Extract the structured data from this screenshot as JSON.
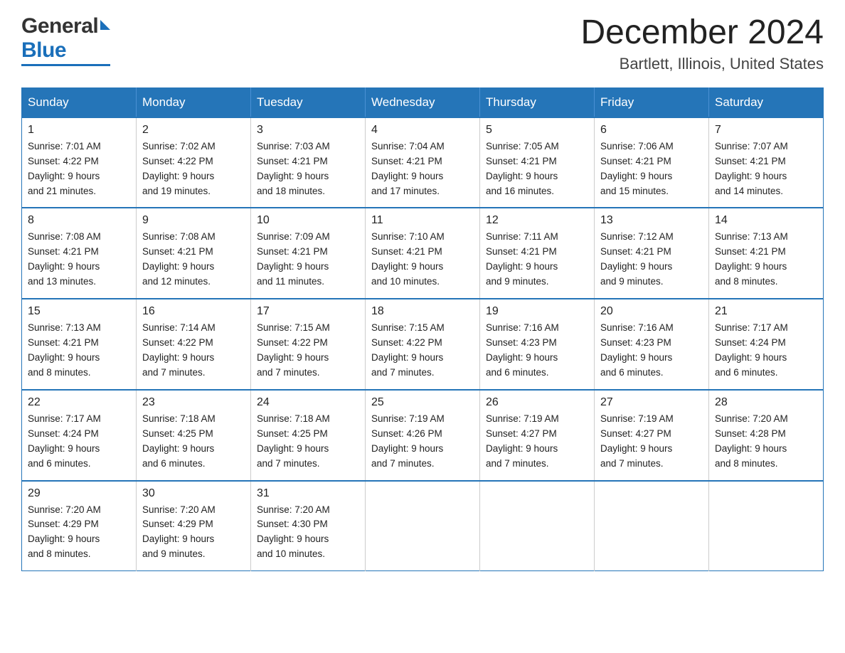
{
  "logo": {
    "general_text": "General",
    "blue_text": "Blue"
  },
  "title": {
    "month_year": "December 2024",
    "location": "Bartlett, Illinois, United States"
  },
  "days_of_week": [
    "Sunday",
    "Monday",
    "Tuesday",
    "Wednesday",
    "Thursday",
    "Friday",
    "Saturday"
  ],
  "weeks": [
    [
      {
        "day": "1",
        "info": "Sunrise: 7:01 AM\nSunset: 4:22 PM\nDaylight: 9 hours\nand 21 minutes."
      },
      {
        "day": "2",
        "info": "Sunrise: 7:02 AM\nSunset: 4:22 PM\nDaylight: 9 hours\nand 19 minutes."
      },
      {
        "day": "3",
        "info": "Sunrise: 7:03 AM\nSunset: 4:21 PM\nDaylight: 9 hours\nand 18 minutes."
      },
      {
        "day": "4",
        "info": "Sunrise: 7:04 AM\nSunset: 4:21 PM\nDaylight: 9 hours\nand 17 minutes."
      },
      {
        "day": "5",
        "info": "Sunrise: 7:05 AM\nSunset: 4:21 PM\nDaylight: 9 hours\nand 16 minutes."
      },
      {
        "day": "6",
        "info": "Sunrise: 7:06 AM\nSunset: 4:21 PM\nDaylight: 9 hours\nand 15 minutes."
      },
      {
        "day": "7",
        "info": "Sunrise: 7:07 AM\nSunset: 4:21 PM\nDaylight: 9 hours\nand 14 minutes."
      }
    ],
    [
      {
        "day": "8",
        "info": "Sunrise: 7:08 AM\nSunset: 4:21 PM\nDaylight: 9 hours\nand 13 minutes."
      },
      {
        "day": "9",
        "info": "Sunrise: 7:08 AM\nSunset: 4:21 PM\nDaylight: 9 hours\nand 12 minutes."
      },
      {
        "day": "10",
        "info": "Sunrise: 7:09 AM\nSunset: 4:21 PM\nDaylight: 9 hours\nand 11 minutes."
      },
      {
        "day": "11",
        "info": "Sunrise: 7:10 AM\nSunset: 4:21 PM\nDaylight: 9 hours\nand 10 minutes."
      },
      {
        "day": "12",
        "info": "Sunrise: 7:11 AM\nSunset: 4:21 PM\nDaylight: 9 hours\nand 9 minutes."
      },
      {
        "day": "13",
        "info": "Sunrise: 7:12 AM\nSunset: 4:21 PM\nDaylight: 9 hours\nand 9 minutes."
      },
      {
        "day": "14",
        "info": "Sunrise: 7:13 AM\nSunset: 4:21 PM\nDaylight: 9 hours\nand 8 minutes."
      }
    ],
    [
      {
        "day": "15",
        "info": "Sunrise: 7:13 AM\nSunset: 4:21 PM\nDaylight: 9 hours\nand 8 minutes."
      },
      {
        "day": "16",
        "info": "Sunrise: 7:14 AM\nSunset: 4:22 PM\nDaylight: 9 hours\nand 7 minutes."
      },
      {
        "day": "17",
        "info": "Sunrise: 7:15 AM\nSunset: 4:22 PM\nDaylight: 9 hours\nand 7 minutes."
      },
      {
        "day": "18",
        "info": "Sunrise: 7:15 AM\nSunset: 4:22 PM\nDaylight: 9 hours\nand 7 minutes."
      },
      {
        "day": "19",
        "info": "Sunrise: 7:16 AM\nSunset: 4:23 PM\nDaylight: 9 hours\nand 6 minutes."
      },
      {
        "day": "20",
        "info": "Sunrise: 7:16 AM\nSunset: 4:23 PM\nDaylight: 9 hours\nand 6 minutes."
      },
      {
        "day": "21",
        "info": "Sunrise: 7:17 AM\nSunset: 4:24 PM\nDaylight: 9 hours\nand 6 minutes."
      }
    ],
    [
      {
        "day": "22",
        "info": "Sunrise: 7:17 AM\nSunset: 4:24 PM\nDaylight: 9 hours\nand 6 minutes."
      },
      {
        "day": "23",
        "info": "Sunrise: 7:18 AM\nSunset: 4:25 PM\nDaylight: 9 hours\nand 6 minutes."
      },
      {
        "day": "24",
        "info": "Sunrise: 7:18 AM\nSunset: 4:25 PM\nDaylight: 9 hours\nand 7 minutes."
      },
      {
        "day": "25",
        "info": "Sunrise: 7:19 AM\nSunset: 4:26 PM\nDaylight: 9 hours\nand 7 minutes."
      },
      {
        "day": "26",
        "info": "Sunrise: 7:19 AM\nSunset: 4:27 PM\nDaylight: 9 hours\nand 7 minutes."
      },
      {
        "day": "27",
        "info": "Sunrise: 7:19 AM\nSunset: 4:27 PM\nDaylight: 9 hours\nand 7 minutes."
      },
      {
        "day": "28",
        "info": "Sunrise: 7:20 AM\nSunset: 4:28 PM\nDaylight: 9 hours\nand 8 minutes."
      }
    ],
    [
      {
        "day": "29",
        "info": "Sunrise: 7:20 AM\nSunset: 4:29 PM\nDaylight: 9 hours\nand 8 minutes."
      },
      {
        "day": "30",
        "info": "Sunrise: 7:20 AM\nSunset: 4:29 PM\nDaylight: 9 hours\nand 9 minutes."
      },
      {
        "day": "31",
        "info": "Sunrise: 7:20 AM\nSunset: 4:30 PM\nDaylight: 9 hours\nand 10 minutes."
      },
      {
        "day": "",
        "info": ""
      },
      {
        "day": "",
        "info": ""
      },
      {
        "day": "",
        "info": ""
      },
      {
        "day": "",
        "info": ""
      }
    ]
  ]
}
